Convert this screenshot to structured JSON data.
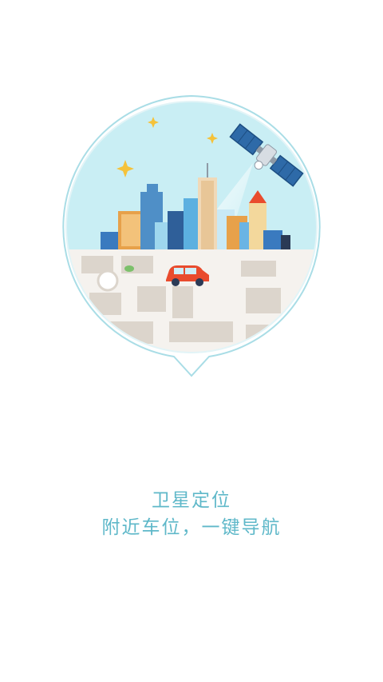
{
  "splash": {
    "title": "卫星定位",
    "subtitle": "附近车位，一键导航"
  },
  "colors": {
    "accent": "#5fb8c9",
    "sky": "#c9eef4",
    "car": "#e94b2d",
    "star": "#f5c23a",
    "map_road": "#f5f2ee",
    "map_block": "#dcd5cc"
  },
  "icons": {
    "satellite": "satellite-icon",
    "car": "car-icon",
    "location_pin": "location-pin-icon"
  }
}
